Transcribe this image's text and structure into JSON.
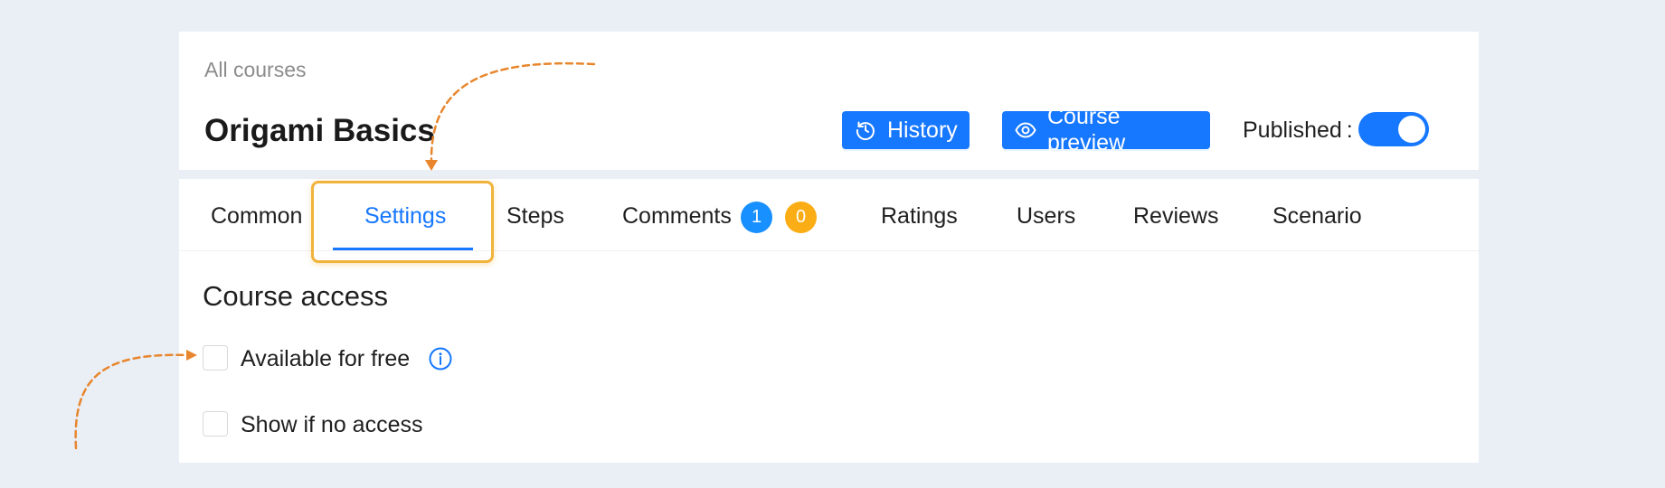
{
  "header": {
    "breadcrumb": "All courses",
    "title": "Origami Basics",
    "history_label": "History",
    "history_icon": "history-icon",
    "preview_label": "Course preview",
    "preview_icon": "eye-icon",
    "published_label": "Published :",
    "published": true
  },
  "tabs": [
    {
      "label": "Common",
      "active": false
    },
    {
      "label": "Settings",
      "active": true
    },
    {
      "label": "Steps",
      "active": false
    },
    {
      "label": "Comments",
      "active": false,
      "badges": [
        "1",
        "0"
      ]
    },
    {
      "label": "Ratings",
      "active": false
    },
    {
      "label": "Users",
      "active": false
    },
    {
      "label": "Reviews",
      "active": false
    },
    {
      "label": "Scenario",
      "active": false
    }
  ],
  "course_access": {
    "title": "Course access",
    "options": [
      {
        "label": "Available for free",
        "checked": false,
        "info_icon": "info-circle-icon"
      },
      {
        "label": "Show if no access",
        "checked": false
      }
    ]
  },
  "colors": {
    "accent": "#1677ff",
    "badge_blue": "#1890ff",
    "badge_orange": "#faad14",
    "highlight": "#f0b33c",
    "annotation_arrow": "#e8862d",
    "background": "#eaeef5"
  }
}
